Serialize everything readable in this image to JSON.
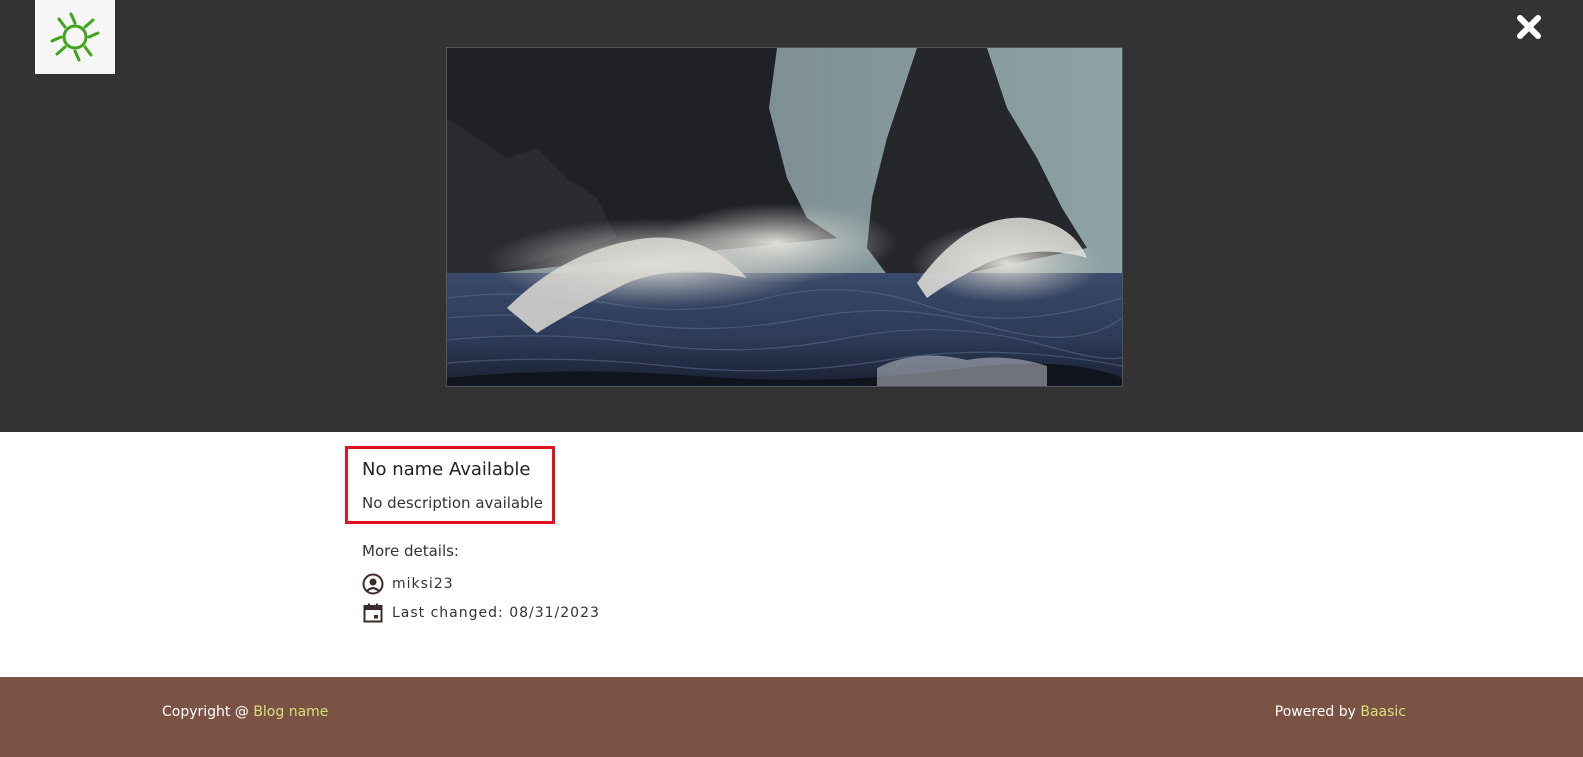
{
  "header": {
    "logo_icon": "sun-logo-icon",
    "close_icon": "close-icon",
    "colors": {
      "background": "#333333",
      "logo_bg": "#f6f6f6",
      "logo_green": "#3fa51b"
    }
  },
  "photo": {
    "subject": "image"
  },
  "details": {
    "title": "No name Available",
    "description": "No description available",
    "more_label": "More details:",
    "author": "miksi23",
    "author_icon": "user-circle-icon",
    "last_changed_label": "Last changed: 08/31/2023",
    "calendar_icon": "calendar-icon",
    "highlight_color": "#e0141e"
  },
  "footer": {
    "copyright_prefix": "Copyright @ ",
    "blog_link": "Blog name",
    "powered_prefix": "Powered by ",
    "powered_link": "Baasic",
    "colors": {
      "background": "#7a5345",
      "link": "#d8e07a"
    }
  }
}
